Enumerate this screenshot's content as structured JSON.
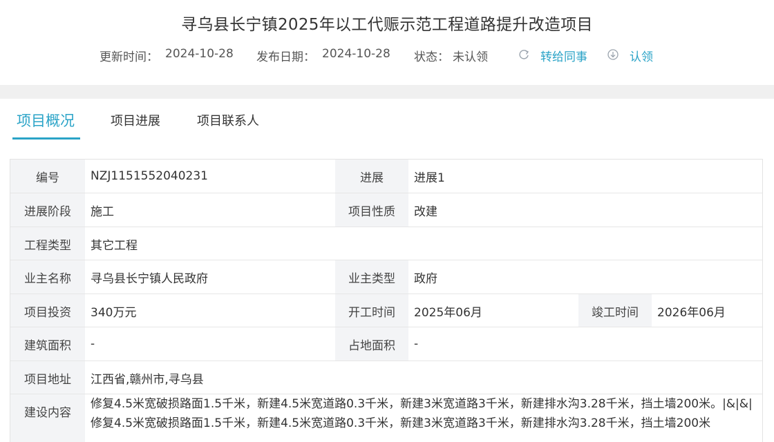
{
  "title": "寻乌县长宁镇2025年以工代赈示范工程道路提升改造项目",
  "meta": {
    "update_label": "更新时间：",
    "update_value": "2024-10-28",
    "publish_label": "发布日期：",
    "publish_value": "2024-10-28",
    "status_label": "状态：",
    "status_value": "未认领",
    "forward_label": "转给同事",
    "claim_label": "认领"
  },
  "tabs": [
    "项目概况",
    "项目进展",
    "项目联系人"
  ],
  "fields": {
    "code_label": "编号",
    "code_value": "NZJ1151552040231",
    "progress_label": "进展",
    "progress_value": "进展1",
    "stage_label": "进展阶段",
    "stage_value": "施工",
    "nature_label": "项目性质",
    "nature_value": "改建",
    "type_label": "工程类型",
    "type_value": "其它工程",
    "owner_label": "业主名称",
    "owner_value": "寻乌县长宁镇人民政府",
    "owner_type_label": "业主类型",
    "owner_type_value": "政府",
    "invest_label": "项目投资",
    "invest_value": "340万元",
    "start_label": "开工时间",
    "start_value": "2025年06月",
    "end_label": "竣工时间",
    "end_value": "2026年06月",
    "area_label": "建筑面积",
    "area_value": "-",
    "land_label": "占地面积",
    "land_value": "-",
    "address_label": "项目地址",
    "address_value": "江西省,赣州市,寻乌县",
    "content_label": "建设内容",
    "content_value": "修复4.5米宽破损路面1.5千米，新建4.5米宽道路0.3千米，新建3米宽道路3千米，新建排水沟3.28千米，挡土墙200米。|&|&|修复4.5米宽破损路面1.5千米，新建4.5米宽道路0.3千米，新建3米宽道路3千米，新建排水沟3.28千米，挡土墙200米"
  },
  "colors": {
    "accent": "#2aa3c7",
    "label_bg": "#f3f4f6",
    "divider": "#f0f0f0"
  }
}
